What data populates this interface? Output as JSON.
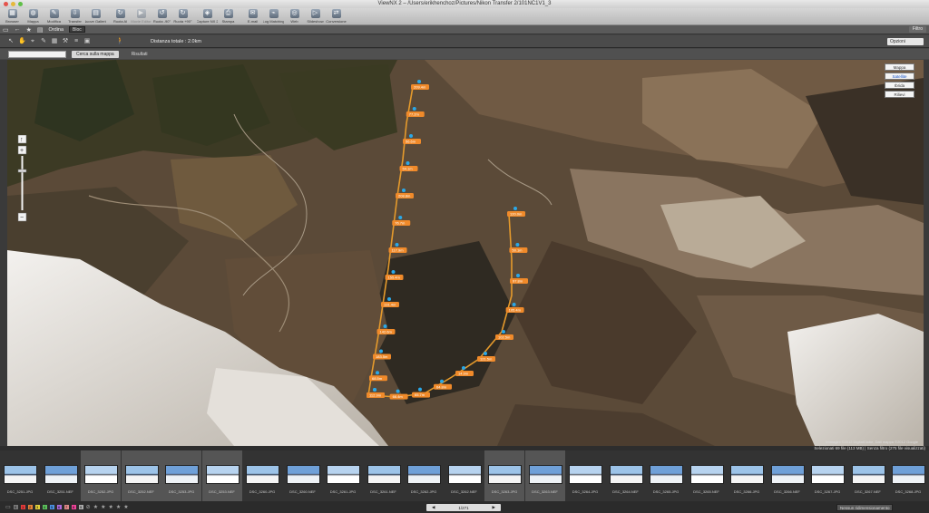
{
  "window": {
    "title": "ViewNX 2 – /Users/erikhenchoz/Pictures/Nikon Transfer 2/101NC1V1_3"
  },
  "toolbar": {
    "items": [
      {
        "label": "Browser",
        "icon": "browser-icon",
        "enabled": true
      },
      {
        "label": "Mappa",
        "icon": "map-icon",
        "enabled": true
      },
      {
        "label": "Modifica",
        "icon": "edit-icon",
        "enabled": true
      },
      {
        "label": "Transfer",
        "icon": "transfer-icon",
        "enabled": true
      },
      {
        "label": "Nuove Gallerie",
        "icon": "folder-icon",
        "enabled": true
      },
      {
        "label": "Ruota Al",
        "icon": "rotate-icon",
        "enabled": true
      },
      {
        "label": "Movie Editor",
        "icon": "movie-icon",
        "enabled": false
      },
      {
        "label": "Ruota -90°",
        "icon": "rotate-left-icon",
        "enabled": true
      },
      {
        "label": "Ruota +90°",
        "icon": "rotate-right-icon",
        "enabled": true
      },
      {
        "label": "Capture NX 2",
        "icon": "capture-icon",
        "enabled": true
      },
      {
        "label": "Stampa",
        "icon": "print-icon",
        "enabled": true
      },
      {
        "label": "E-mail",
        "icon": "email-icon",
        "enabled": true
      },
      {
        "label": "Log Matching",
        "icon": "log-matching-icon",
        "enabled": true
      },
      {
        "label": "Web",
        "icon": "web-icon",
        "enabled": true
      },
      {
        "label": "Slideshow",
        "icon": "slideshow-icon",
        "enabled": true
      },
      {
        "label": "Conversione",
        "icon": "convert-icon",
        "enabled": true
      }
    ]
  },
  "nav": {
    "sort_label": "Ordina",
    "sort_value": "Bloc",
    "filter_label": "Filtro"
  },
  "map_toolbar": {
    "distance": "Distanza totale : 2.0km",
    "options": "Opzioni"
  },
  "search": {
    "button": "Cerca sulla mappa",
    "results": "Risultati"
  },
  "map": {
    "type_buttons": [
      {
        "label": "Mappa",
        "selected": false
      },
      {
        "label": "Satellite",
        "selected": true
      },
      {
        "label": "Ibrida",
        "selected": false
      },
      {
        "label": "Rilievi",
        "selected": false
      }
    ],
    "copyright": "Immagini ©2012 DigitalGlobe, Dati mappa ©2012 Google",
    "track_labels": [
      "209.4m",
      "77.2m",
      "56.6m",
      "54.1m",
      "208.8m",
      "76.7m",
      "117.9m",
      "155.4m",
      "131.4m",
      "142.6m",
      "183.5m",
      "68.5m",
      "73.6m",
      "112.9m",
      "66.4m",
      "65.7m",
      "64.8m",
      "14.9m",
      "121.5m",
      "102.5m",
      "105.4m",
      "97.8m",
      "50.1m",
      "120.0m"
    ],
    "track_color": "#e59a2c"
  },
  "filmstrip": {
    "info": "Selezionati 69 file (113 MB) | Senza filtro (275 file visualizzati)",
    "thumbs": [
      {
        "label": "DSC_3251.JPG",
        "sel": false
      },
      {
        "label": "DSC_3251.NEF",
        "sel": false
      },
      {
        "label": "DSC_3252.JPG",
        "sel": true
      },
      {
        "label": "DSC_3252.NEF",
        "sel": true
      },
      {
        "label": "DSC_3253.JPG",
        "sel": true
      },
      {
        "label": "DSC_3253.NEF",
        "sel": true
      },
      {
        "label": "DSC_3260.JPG",
        "sel": false
      },
      {
        "label": "DSC_3260.NEF",
        "sel": false
      },
      {
        "label": "DSC_3261.JPG",
        "sel": false
      },
      {
        "label": "DSC_3261.NEF",
        "sel": false
      },
      {
        "label": "DSC_3262.JPG",
        "sel": false
      },
      {
        "label": "DSC_3262.NEF",
        "sel": false
      },
      {
        "label": "DSC_3263.JPG",
        "sel": true
      },
      {
        "label": "DSC_3263.NEF",
        "sel": true
      },
      {
        "label": "DSC_3264.JPG",
        "sel": false
      },
      {
        "label": "DSC_3264.NEF",
        "sel": false
      },
      {
        "label": "DSC_3265.JPG",
        "sel": false
      },
      {
        "label": "DSC_3265.NEF",
        "sel": false
      },
      {
        "label": "DSC_3266.JPG",
        "sel": false
      },
      {
        "label": "DSC_3266.NEF",
        "sel": false
      },
      {
        "label": "DSC_3267.JPG",
        "sel": false
      },
      {
        "label": "DSC_3267.NEF",
        "sel": false
      },
      {
        "label": "DSC_3268.JPG",
        "sel": false
      }
    ]
  },
  "statusbar": {
    "labels": [
      "0",
      "1",
      "2",
      "3",
      "4",
      "5",
      "6",
      "7",
      "8",
      "9"
    ],
    "label_colors": [
      "#777",
      "#e23b3b",
      "#e8833a",
      "#e3d23c",
      "#5cc15c",
      "#4b8fe0",
      "#b06bdf",
      "#d88",
      "#e49",
      "#aaa"
    ],
    "page": "1/271",
    "size_select": "Nessun ridimensionamento"
  }
}
